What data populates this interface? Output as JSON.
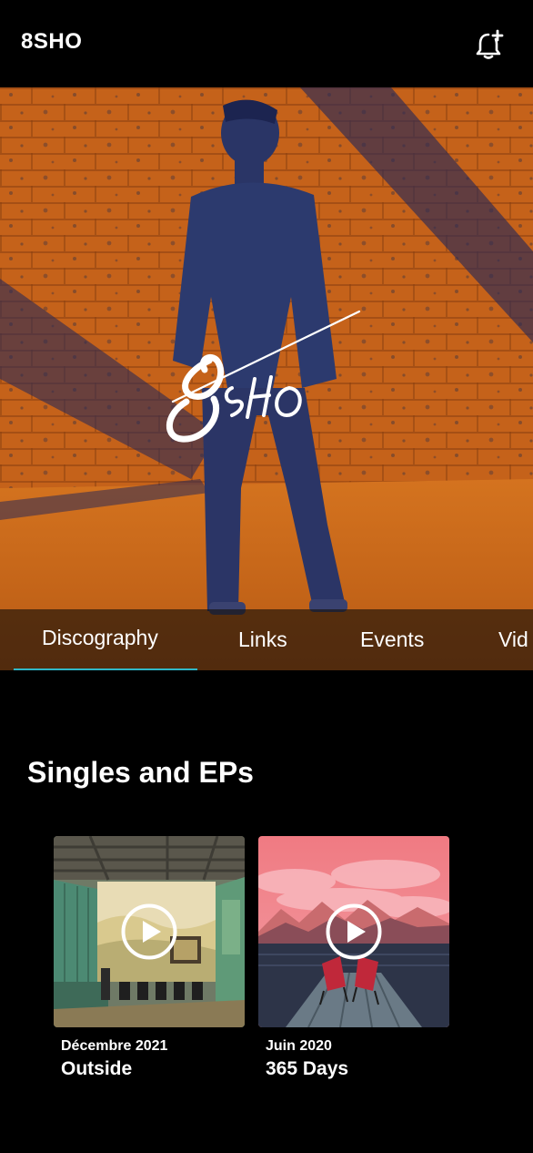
{
  "header": {
    "title": "8SHO",
    "notify_icon": "bell-plus-icon"
  },
  "hero": {
    "logo_text": "8SHO"
  },
  "tabs": [
    {
      "label": "Discography",
      "active": true
    },
    {
      "label": "Links",
      "active": false
    },
    {
      "label": "Events",
      "active": false
    },
    {
      "label": "Vid",
      "active": false
    }
  ],
  "colors": {
    "accent": "#2fb7c6",
    "hero_orange": "#c8641a",
    "hero_blue": "#2a3566"
  },
  "section": {
    "title": "Singles and EPs"
  },
  "releases": [
    {
      "date": "Décembre 2021",
      "title": "Outside",
      "icon": "play-icon"
    },
    {
      "date": "Juin 2020",
      "title": "365 Days",
      "icon": "play-icon"
    }
  ]
}
